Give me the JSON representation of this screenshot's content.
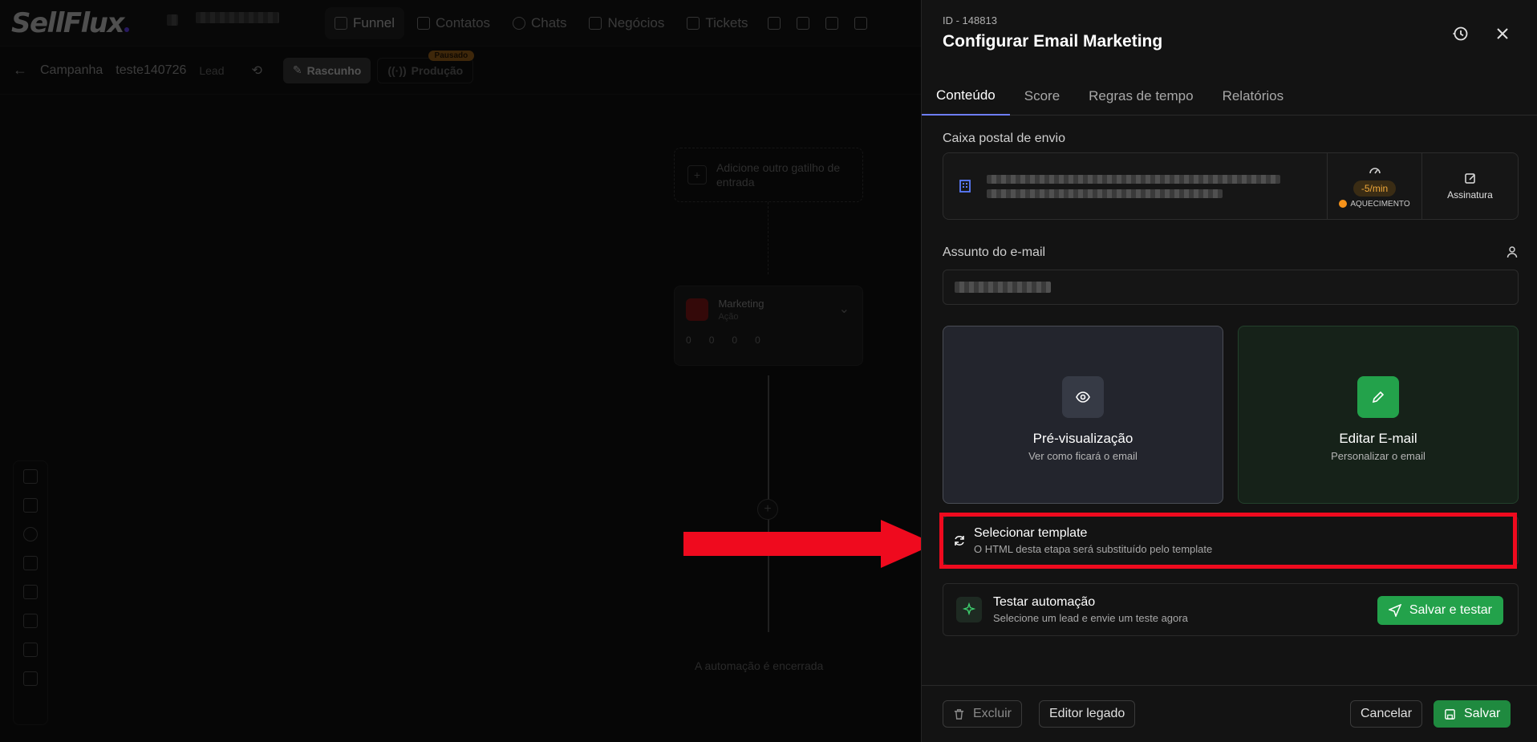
{
  "background": {
    "logo": "SellFlux",
    "nav": [
      {
        "label": "Funnel",
        "icon": "rocket-icon"
      },
      {
        "label": "Contatos",
        "icon": "contacts-icon"
      },
      {
        "label": "Chats",
        "icon": "chat-icon"
      },
      {
        "label": "Negócios",
        "icon": "briefcase-icon"
      },
      {
        "label": "Tickets",
        "icon": "ticket-icon"
      }
    ],
    "breadcrumb": {
      "root": "Campanha",
      "name": "teste140726",
      "type": "Lead"
    },
    "draft_label": "Rascunho",
    "production_label": "Produção",
    "paused_badge": "Pausado",
    "add_trigger_text": "Adicione outro gatilho de entrada",
    "node": {
      "title": "Marketing",
      "subtitle": "Ação",
      "stats": [
        "0",
        "0",
        "0",
        "0"
      ]
    },
    "end_text": "A automação é encerrada"
  },
  "panel": {
    "id_label": "ID - 148813",
    "title": "Configurar Email Marketing",
    "tabs": [
      "Conteúdo",
      "Score",
      "Regras de tempo",
      "Relatórios"
    ],
    "mailbox_label": "Caixa postal de envio",
    "rate": "-5/min",
    "warmup": "AQUECIMENTO",
    "signature": "Assinatura",
    "subject_label": "Assunto do e-mail",
    "preview": {
      "title": "Pré-visualização",
      "subtitle": "Ver como ficará o email"
    },
    "edit": {
      "title": "Editar E-mail",
      "subtitle": "Personalizar o email"
    },
    "template": {
      "title": "Selecionar template",
      "subtitle": "O HTML desta etapa será substituído pelo template"
    },
    "test": {
      "title": "Testar automação",
      "subtitle": "Selecione um lead e envie um teste agora",
      "button": "Salvar e testar"
    },
    "footer": {
      "delete": "Excluir",
      "legacy": "Editor legado",
      "cancel": "Cancelar",
      "save": "Salvar"
    }
  },
  "colors": {
    "accent_green": "#23a24b",
    "tab_underline": "#6e7eff",
    "highlight_red": "#ef0a1e",
    "rate_orange": "#f0a83a"
  }
}
